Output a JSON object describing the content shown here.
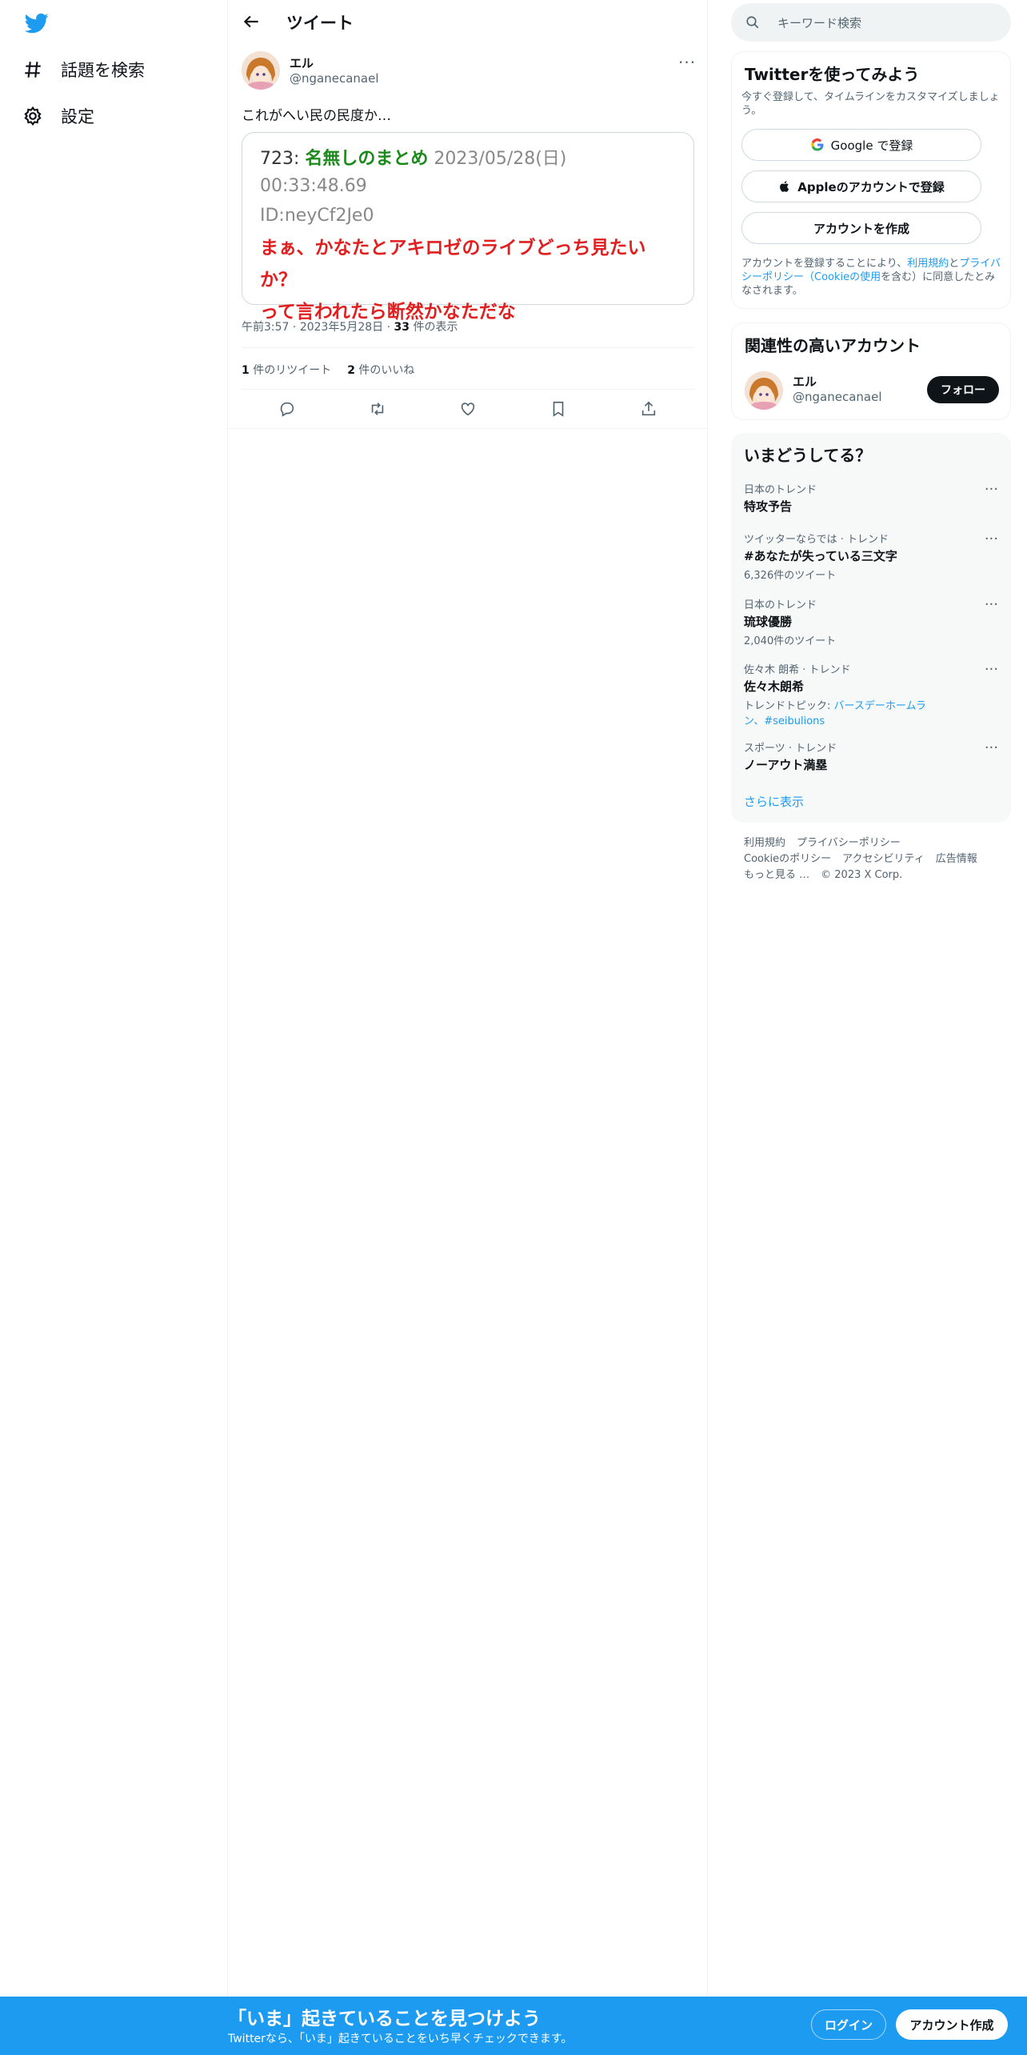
{
  "nav": {
    "items": [
      {
        "label": "話題を検索",
        "icon": "hashtag-icon"
      },
      {
        "label": "設定",
        "icon": "gear-icon"
      }
    ]
  },
  "header": {
    "title": "ツイート"
  },
  "tweet": {
    "author_name": "エル",
    "author_handle": "@nganecanael",
    "text": "これがへい民の民度か…",
    "card": {
      "number": "723:",
      "poster_name": "名無しのまとめ",
      "datetime": "2023/05/28(日) 00:33:48.69",
      "id": "ID:neyCf2Je0",
      "line1": "まぁ、かなたとアキロゼのライブどっち見たいか？",
      "line2": "って言われたら断然かなただな"
    },
    "time": "午前3:57",
    "date": "2023年5月28日",
    "views_count": "33",
    "views_label": "件の表示",
    "retweets_count": "1",
    "retweets_label": "件のリツイート",
    "likes_count": "2",
    "likes_label": "件のいいね"
  },
  "search": {
    "placeholder": "キーワード検索"
  },
  "signup": {
    "title": "Twitterを使ってみよう",
    "subtitle": "今すぐ登録して、タイムラインをカスタマイズしましょう。",
    "google_label": "Google で登録",
    "apple_label": "Appleのアカウントで登録",
    "create_label": "アカウントを作成",
    "terms_prefix": "アカウントを登録することにより、",
    "terms_link": "利用規約",
    "terms_and": "と",
    "privacy_link": "プライバシーポリシー",
    "cookie_paren_open": "（",
    "cookie_link": "Cookieの使用",
    "terms_suffix": "を含む）に同意したとみなされます。"
  },
  "related": {
    "title": "関連性の高いアカウント",
    "name": "エル",
    "handle": "@nganecanael",
    "follow_label": "フォロー"
  },
  "trends": {
    "title": "いまどうしてる？",
    "items": [
      {
        "context": "日本のトレンド",
        "name": "特攻予告",
        "count": ""
      },
      {
        "context": "ツイッターならでは · トレンド",
        "name": "#あなたが失っている三文字",
        "count": "6,326件のツイート"
      },
      {
        "context": "日本のトレンド",
        "name": "琉球優勝",
        "count": "2,040件のツイート"
      },
      {
        "context": "佐々木 朗希 · トレンド",
        "name": "佐々木朗希",
        "topic_prefix": "トレンドトピック: ",
        "topic_links": "バースデーホームラン、#seibulions"
      },
      {
        "context": "スポーツ · トレンド",
        "name": "ノーアウト満塁",
        "count": ""
      }
    ],
    "show_more": "さらに表示"
  },
  "footer": {
    "links": [
      "利用規約",
      "プライバシーポリシー",
      "Cookieのポリシー",
      "アクセシビリティ",
      "広告情報",
      "もっと見る …"
    ],
    "copyright": "© 2023 X Corp."
  },
  "banner": {
    "title": "「いま」起きていることを見つけよう",
    "subtitle": "Twitterなら、「いま」起きていることをいち早くチェックできます。",
    "login_label": "ログイン",
    "signup_label": "アカウント作成"
  },
  "colors": {
    "accent": "#1d9bf0",
    "card_name": "#1a8a1a",
    "card_red": "#e02020"
  }
}
